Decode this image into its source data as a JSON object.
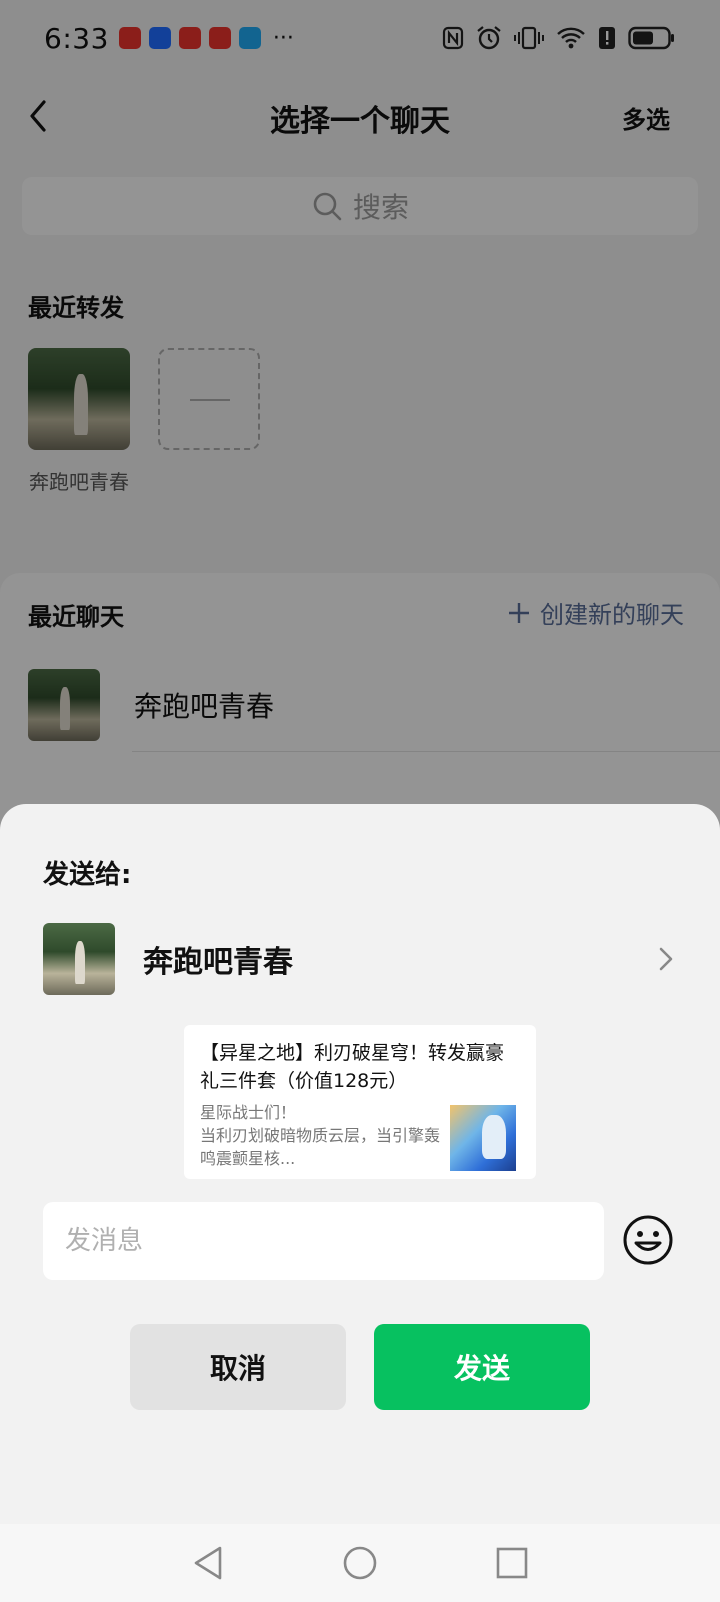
{
  "status_bar": {
    "time": "6:33",
    "more": "···",
    "notification_icons": [
      "huawei-appgallery-icon",
      "browser-icon",
      "huawei-appgallery-icon",
      "huawei-appgallery-icon",
      "search-app-icon"
    ],
    "indicators": [
      "nfc-icon",
      "alarm-icon",
      "vibrate-icon",
      "wifi-icon",
      "alert-icon",
      "battery-icon"
    ]
  },
  "header": {
    "title": "选择一个聊天",
    "multi_select": "多选"
  },
  "search": {
    "placeholder": "搜索"
  },
  "recent_forward": {
    "title": "最近转发",
    "items": [
      {
        "name": "奔跑吧青春"
      }
    ]
  },
  "recent_chats": {
    "title": "最近聊天",
    "create_new": "创建新的聊天",
    "items": [
      {
        "name": "奔跑吧青春"
      }
    ]
  },
  "dialog": {
    "send_to_label": "发送给:",
    "recipient_name": "奔跑吧青春",
    "card": {
      "title": "【异星之地】利刃破星穹！转发赢豪礼三件套（价值128元）",
      "description": "星际战士们！\n当利刃划破暗物质云层，当引擎轰鸣震颤星核..."
    },
    "message_placeholder": "发消息",
    "cancel_label": "取消",
    "send_label": "发送"
  },
  "colors": {
    "primary_green": "#07c160",
    "link_blue": "#576b95",
    "overlay": "rgba(0,0,0,0.4)"
  }
}
